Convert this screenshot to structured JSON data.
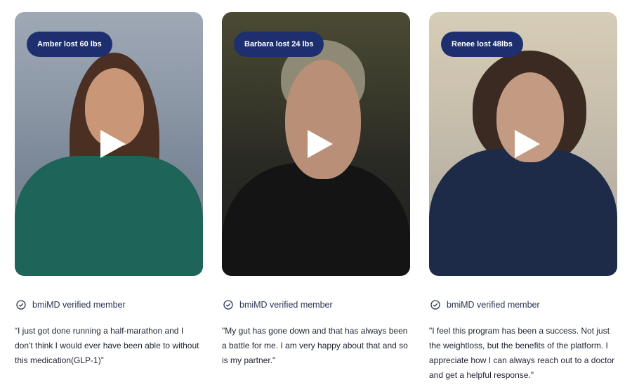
{
  "testimonials": [
    {
      "name_badge": "Amber lost 60 lbs",
      "verified_label": "bmiMD verified member",
      "quote": "“I just got done running a half-marathon and I don't think I would ever have been able to without this medication(GLP-1)”"
    },
    {
      "name_badge": "Barbara lost 24 lbs",
      "verified_label": "bmiMD verified member",
      "quote": "\"My gut has gone down and that has always been a battle for me. I am very happy about that and so is my partner.\""
    },
    {
      "name_badge": "Renee lost 48lbs",
      "verified_label": "bmiMD verified member",
      "quote": "\"I feel this program has been a success. Not just the weightloss, but the benefits of the platform. I appreciate how I can always reach out to a doctor and get a helpful response.\""
    }
  ],
  "colors": {
    "badge_bg": "#1d2f6f",
    "badge_text": "#ffffff",
    "verified_icon": "#2b3553"
  },
  "icons": {
    "play": "play-icon",
    "verified": "check-circle-icon"
  }
}
